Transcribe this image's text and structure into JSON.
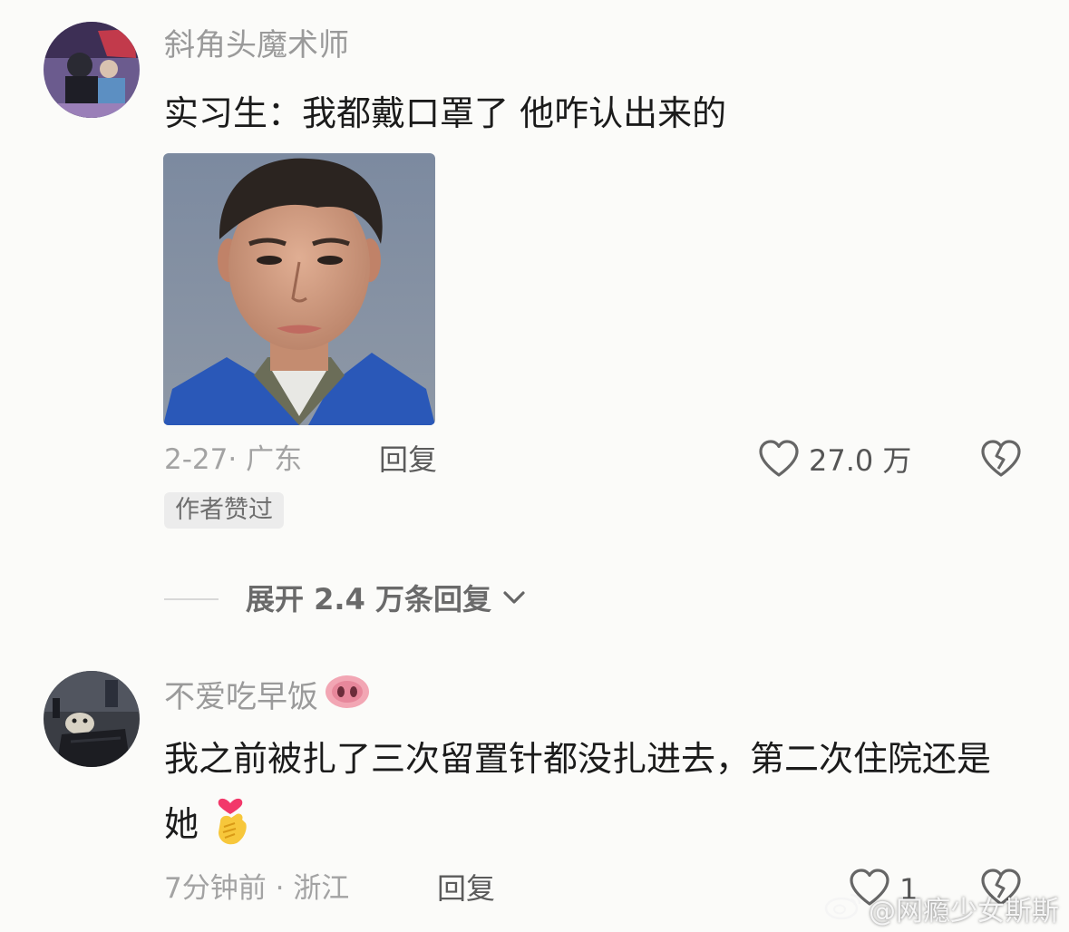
{
  "comments": [
    {
      "username": "斜角头魔术师",
      "text": "实习生：我都戴口罩了 他咋认出来的",
      "date": "2-27",
      "location_sep": "·",
      "location": "广东",
      "reply_label": "回复",
      "like_count": "27.0 万",
      "author_badge": "作者赞过",
      "expand_label": "展开 2.4 万条回复"
    },
    {
      "username": "不爱吃早饭",
      "username_emoji": "pig-nose-emoji",
      "text": "我之前被扎了三次留置针都没扎进去，第二次住院还是她",
      "text_emoji": "finger-heart-emoji",
      "date": "7分钟前",
      "location_sep": "·",
      "location": "浙江",
      "reply_label": "回复",
      "like_count": "1"
    }
  ],
  "watermark": {
    "text": "@网瘾少女斯斯",
    "icon": "weibo-icon"
  },
  "colors": {
    "background": "#fbfbf9",
    "username": "#9a9a9a",
    "text": "#1b1b1b",
    "meta": "#a3a3a3"
  }
}
